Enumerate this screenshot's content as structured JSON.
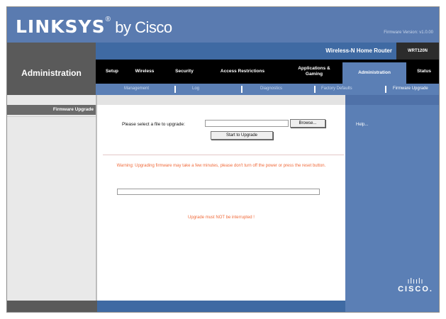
{
  "header": {
    "brand": "LINKSYS",
    "brand_tm": "®",
    "brand_suffix": "by Cisco",
    "firmware_version": "Firmware Version: v1.0.00"
  },
  "title_bar": {
    "section": "Administration",
    "product_name": "Wireless-N Home Router",
    "model": "WRT120N"
  },
  "tabs": [
    {
      "label": "Setup"
    },
    {
      "label": "Wireless"
    },
    {
      "label": "Security"
    },
    {
      "label": "Access Restrictions"
    },
    {
      "label": "Applications & Gaming"
    },
    {
      "label": "Administration",
      "active": true
    },
    {
      "label": "Status"
    }
  ],
  "subtabs": [
    {
      "label": "Management"
    },
    {
      "label": "Log"
    },
    {
      "label": "Diagnostics"
    },
    {
      "label": "Factory Defaults"
    },
    {
      "label": "Firmware Upgrade",
      "active": true
    }
  ],
  "left_pane": {
    "section_label": "Firmware Upgrade"
  },
  "content": {
    "upgrade_label": "Please select a file to upgrade:",
    "file_value": "",
    "browse_label": "Browse...",
    "start_label": "Start to Upgrade",
    "warning": "Warning: Upgrading firmware may take a few minutes, please don't turn off the power or press the reset button.",
    "progress_value": 0,
    "note": "Upgrade must NOT be interrupted !"
  },
  "right_pane": {
    "help_label": "Help..."
  },
  "cisco_logo": {
    "bars": "ılıılı",
    "word": "CISCO."
  },
  "colors": {
    "header_blue": "#5a7bb0",
    "tab_active": "#5b7fb5",
    "warning_orange": "#f06a3a"
  }
}
